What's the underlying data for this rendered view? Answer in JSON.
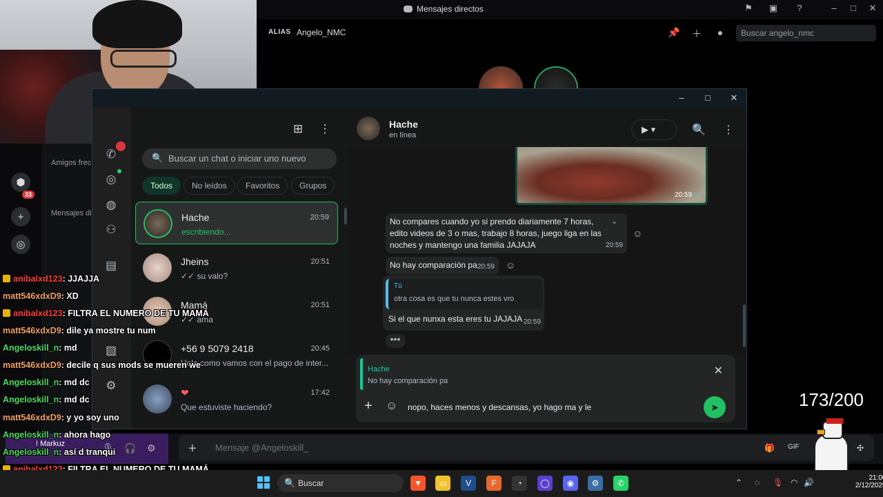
{
  "discord": {
    "window_title": "Mensajes directos",
    "alias_label": "ALIAS",
    "alias_name": "Angelo_NMC",
    "search_placeholder": "Buscar angelo_nmc",
    "friends_label": "Amigos frec",
    "dm_label": "Mensajes di",
    "server_badge": "33",
    "message_placeholder": "Mensaje @Angeloskill_",
    "user_name": "! Markuz"
  },
  "whatsapp": {
    "search_placeholder": "Buscar un chat o iniciar uno nuevo",
    "filters": [
      "Todos",
      "No leídos",
      "Favoritos",
      "Grupos"
    ],
    "chats": [
      {
        "name": "Hache",
        "time": "20:59",
        "preview": "escribiendo..."
      },
      {
        "name": "Jheins",
        "time": "20:51",
        "preview": "✓✓ su valo?"
      },
      {
        "name": "Mamá",
        "time": "20:51",
        "preview": "✓✓ ama"
      },
      {
        "name": "+56 9 5079 2418",
        "time": "20:45",
        "preview": "Hola como vamos con el pago de inter..."
      },
      {
        "name": "❤",
        "time": "17:42",
        "preview": "Que estuviste haciendo?"
      }
    ],
    "conversation": {
      "name": "Hache",
      "status": "en línea",
      "image_time": "20:59",
      "messages": [
        {
          "text": "No compares cuando yo si prendo diariamente 7 horas, edito videos de 3 o mas, trabajo 8 horas, juego liga en las noches y mantengo una familia JAJAJA",
          "time": "20:59"
        },
        {
          "text": "No hay comparación pa",
          "time": "20:59"
        },
        {
          "quote_author": "Tú",
          "quote_text": "otra cosa es que tu nunca estes vro",
          "text": "Si el que nunxa esta eres tu JAJAJA",
          "time": "20:59"
        }
      ],
      "reply_to_author": "Hache",
      "reply_to_text": "No hay comparación pa",
      "draft": "nopo, haces menos y descansas, yo hago ma y le"
    }
  },
  "stream_chat": [
    {
      "user": "anibalxd123",
      "text": ": JJAJJA",
      "color": "#ff3b30"
    },
    {
      "user": "matt546xdxD9",
      "text": ": XD",
      "color": "#f2a35b"
    },
    {
      "user": "anibalxd123",
      "text": ": FILTRA EL NUMERO DE TU MAMÁ",
      "color": "#ff3b30"
    },
    {
      "user": "matt546xdxD9",
      "text": ": dile ya mostre tu num",
      "color": "#f2a35b"
    },
    {
      "user": "Angeloskill_n",
      "text": ": md",
      "color": "#3fe05a"
    },
    {
      "user": "matt546xdxD9",
      "text": ": decile q sus mods se mueren we",
      "color": "#f2a35b"
    },
    {
      "user": "Angeloskill_n",
      "text": ": md dc",
      "color": "#3fe05a"
    },
    {
      "user": "Angeloskill_n",
      "text": ": md dc",
      "color": "#3fe05a"
    },
    {
      "user": "matt546xdxD9",
      "text": ": y yo soy uno",
      "color": "#f2a35b"
    },
    {
      "user": "Angeloskill_n",
      "text": ": ahora hago",
      "color": "#3fe05a"
    },
    {
      "user": "Angeloskill_n",
      "text": ": así d tranqui",
      "color": "#3fe05a"
    },
    {
      "user": "anibalxd123",
      "text": ": FILTRA EL NUMERO DE TU MAMÁ",
      "color": "#ff3b30"
    },
    {
      "user": "anibalxd123",
      "text": ": FILTRA EL NUMERO DE TU MAMÁ",
      "color": "#ff3b30"
    }
  ],
  "goal": "173/200",
  "taskbar": {
    "search_label": "Buscar",
    "time": "21:00",
    "date": "2/12/2025"
  }
}
